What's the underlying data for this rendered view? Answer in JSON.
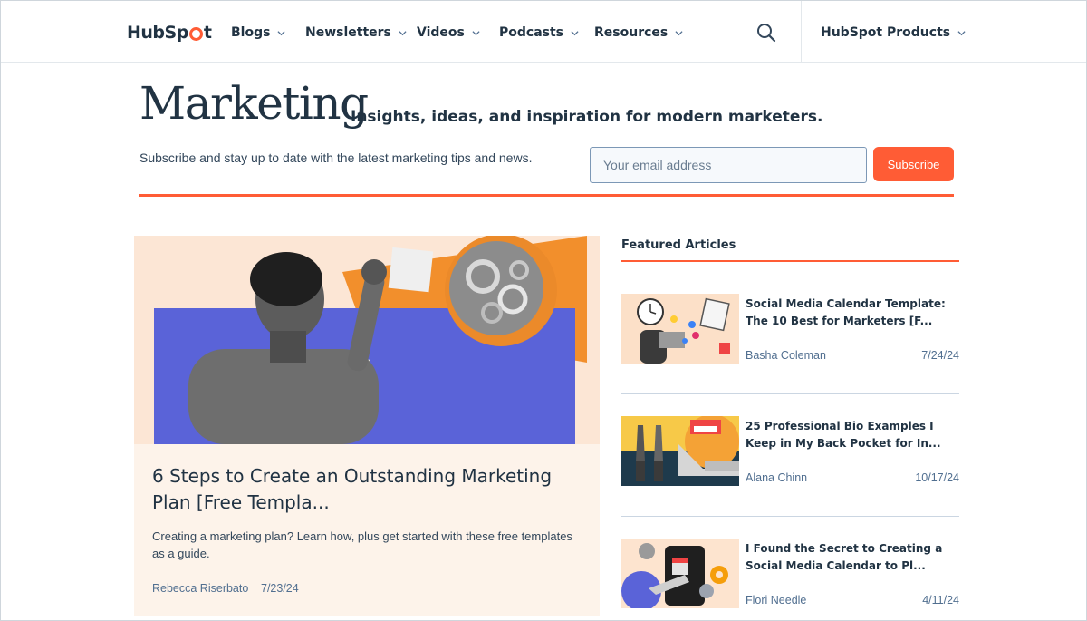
{
  "header": {
    "logo_prefix": "HubSp",
    "logo_suffix": "t",
    "nav": [
      {
        "label": "Blogs"
      },
      {
        "label": "Newsletters"
      },
      {
        "label": "Videos"
      },
      {
        "label": "Podcasts"
      },
      {
        "label": "Resources"
      }
    ],
    "search_icon": "search-icon",
    "products_label": "HubSpot Products"
  },
  "hero": {
    "title": "Marketing",
    "tagline": "Insights, ideas, and inspiration for modern marketers.",
    "subscribe_text": "Subscribe and stay up to date with the latest marketing tips and news.",
    "email_placeholder": "Your email address",
    "subscribe_label": "Subscribe"
  },
  "feature": {
    "title": "6 Steps to Create an Outstanding Marketing Plan [Free Templa...",
    "description": "Creating a marketing plan? Learn how, plus get started with these free templates as a guide.",
    "author": "Rebecca Riserbato",
    "date": "7/23/24"
  },
  "featured_articles": {
    "heading": "Featured Articles",
    "items": [
      {
        "title": "Social Media Calendar Template: The 10 Best for Marketers [F...",
        "author": "Basha Coleman",
        "date": "7/24/24"
      },
      {
        "title": "25 Professional Bio Examples I Keep in My Back Pocket for In...",
        "author": "Alana Chinn",
        "date": "10/17/24"
      },
      {
        "title": "I Found the Secret to Creating a Social Media Calendar to Pl...",
        "author": "Flori Needle",
        "date": "4/11/24"
      }
    ]
  },
  "colors": {
    "brand_orange": "#ff5c35",
    "text_dark": "#213343",
    "card_bg": "#fdf3ea"
  }
}
